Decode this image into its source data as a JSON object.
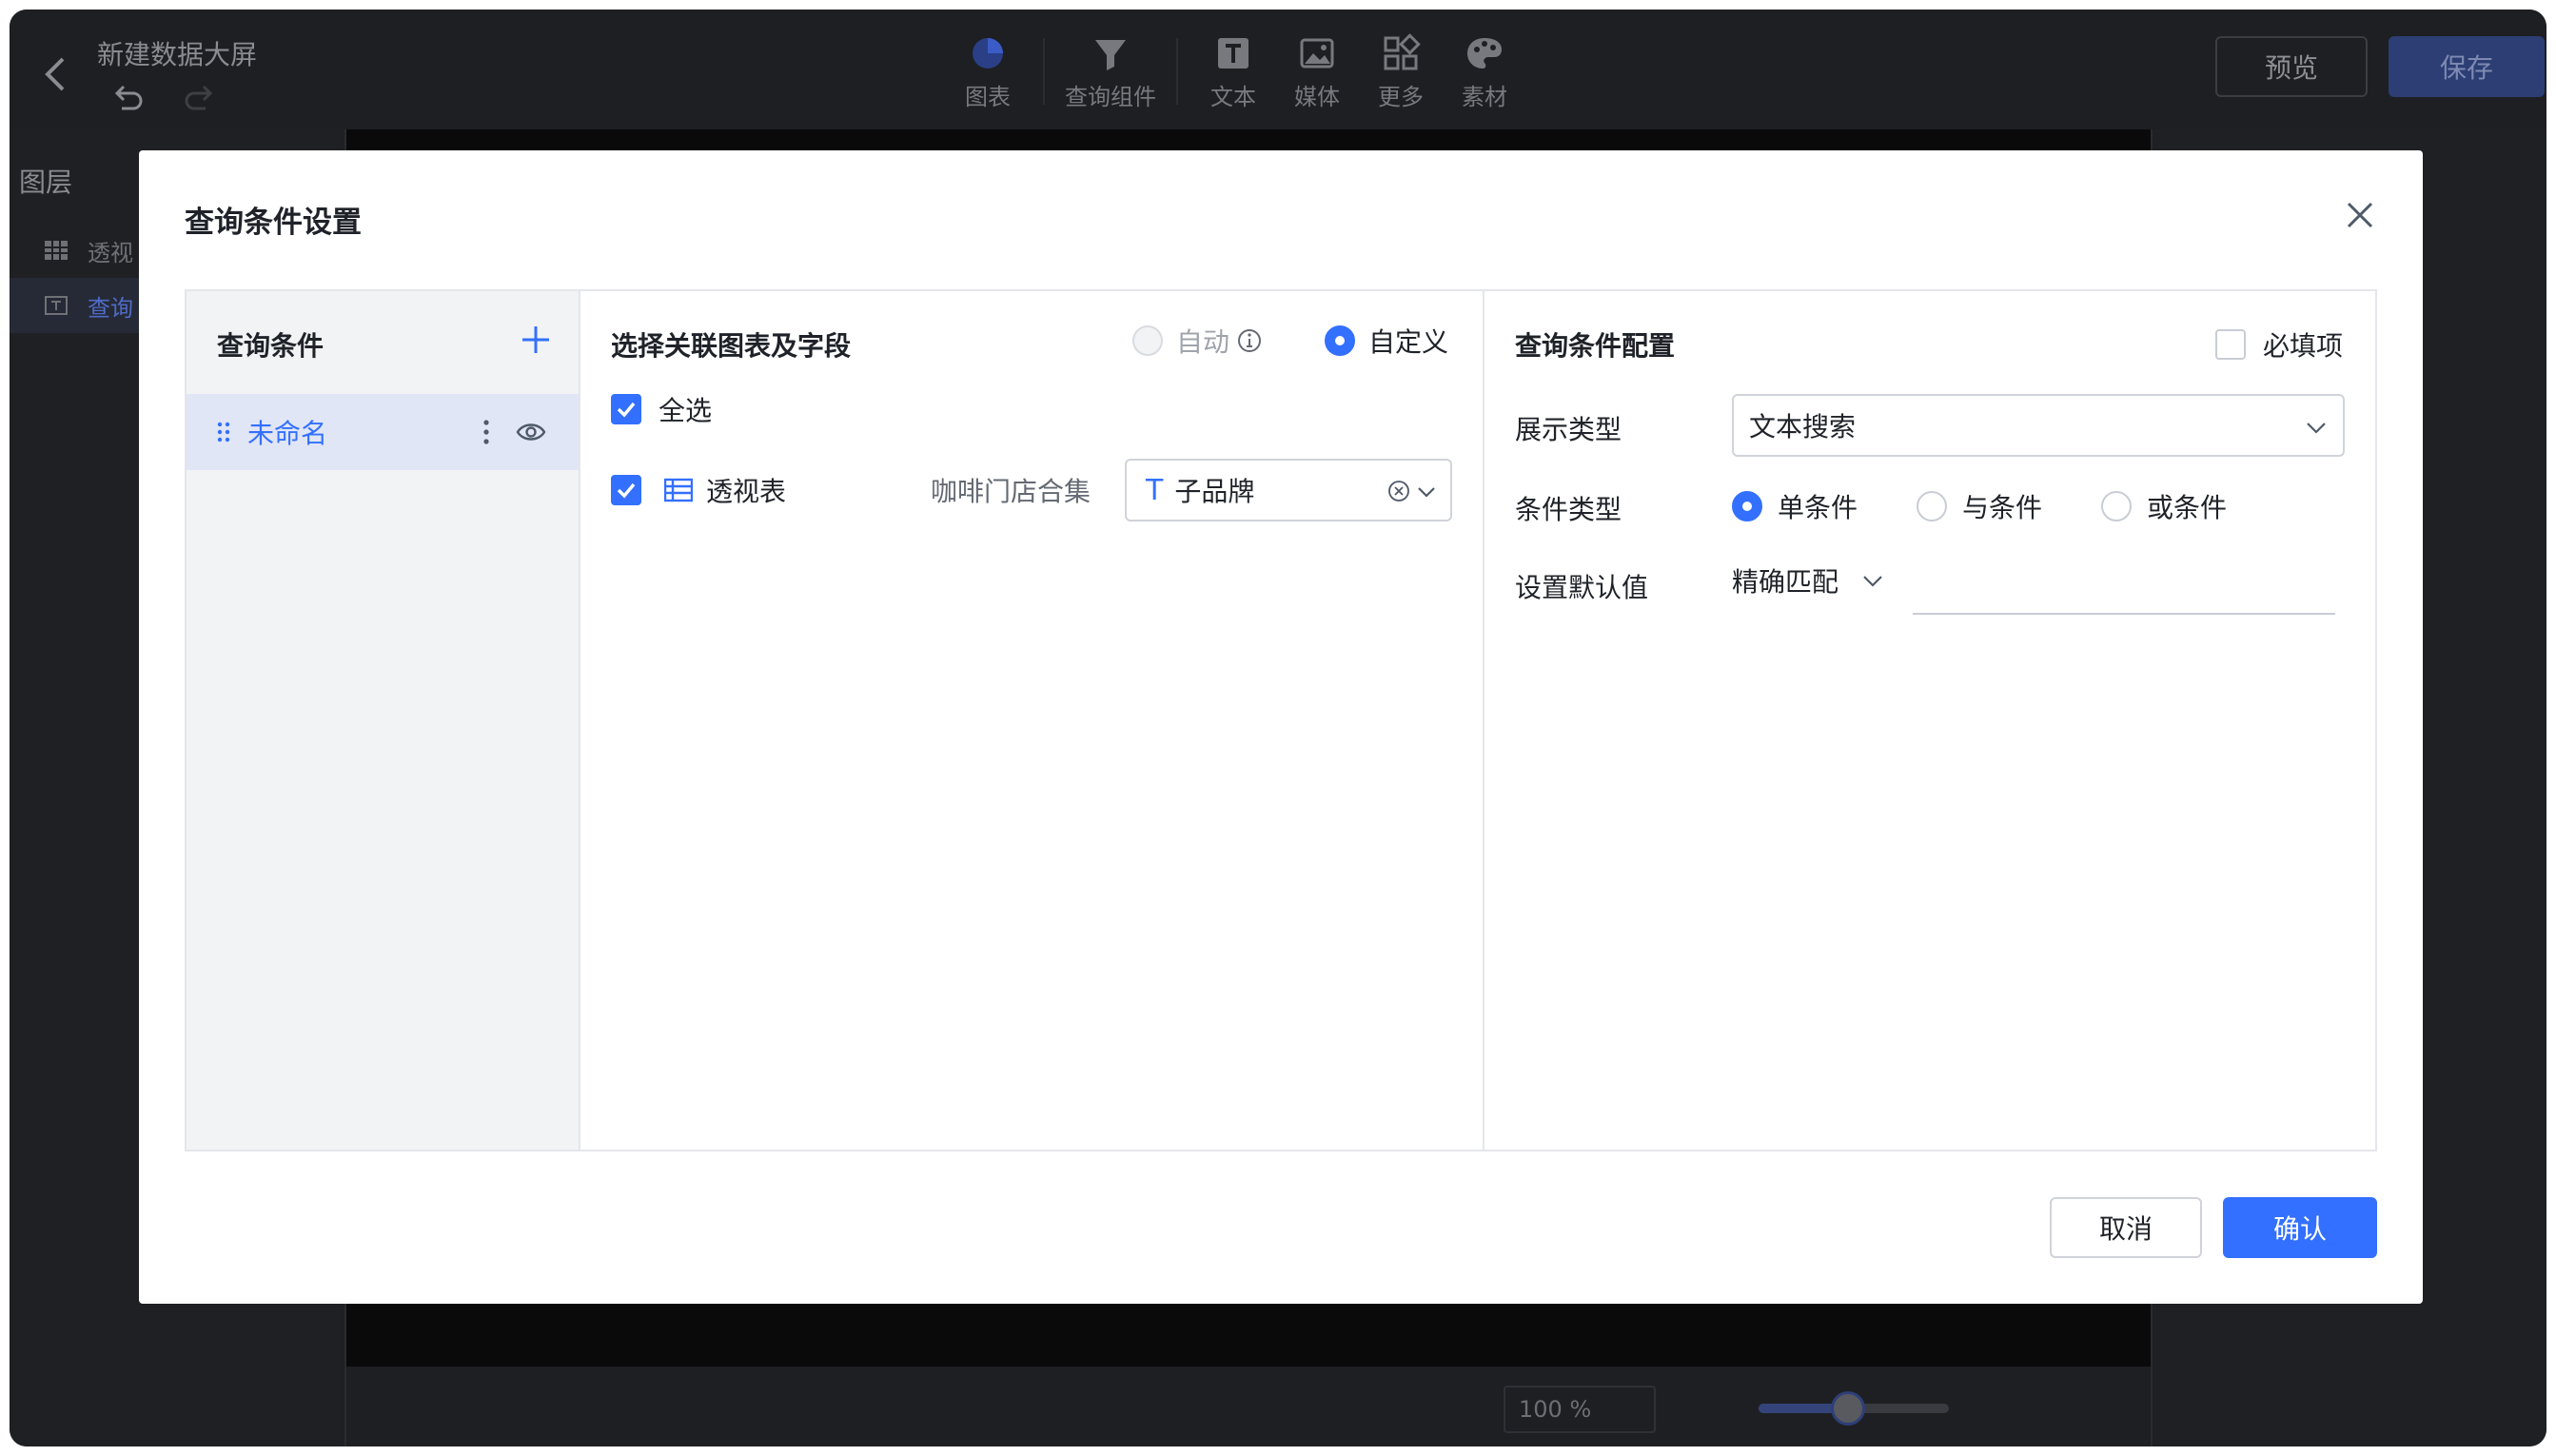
{
  "app": {
    "title": "新建数据大屏",
    "toolbar": [
      {
        "label": "图表",
        "icon": "pie-chart-icon"
      },
      {
        "label": "查询组件",
        "icon": "filter-funnel-icon"
      },
      {
        "label": "文本",
        "icon": "text-icon"
      },
      {
        "label": "媒体",
        "icon": "image-icon"
      },
      {
        "label": "更多",
        "icon": "grid-more-icon"
      },
      {
        "label": "素材",
        "icon": "palette-icon"
      }
    ],
    "preview_label": "预览",
    "save_label": "保存",
    "layers": {
      "title": "图层",
      "items": [
        {
          "label": "透视",
          "icon": "table-icon"
        },
        {
          "label": "查询",
          "icon": "text-box-icon",
          "active": true
        }
      ]
    },
    "zoom": {
      "value": "100",
      "unit": "%"
    }
  },
  "modal": {
    "title": "查询条件设置",
    "conditions": {
      "header": "查询条件",
      "items": [
        {
          "name": "未命名"
        }
      ]
    },
    "association": {
      "header": "选择关联图表及字段",
      "mode_auto": "自动",
      "mode_custom": "自定义",
      "select_all": "全选",
      "charts": [
        {
          "name": "透视表",
          "dataset": "咖啡门店合集",
          "field": "子品牌",
          "field_type_icon": "T"
        }
      ]
    },
    "config": {
      "header": "查询条件配置",
      "required_label": "必填项",
      "display_type_label": "展示类型",
      "display_type_value": "文本搜索",
      "condition_type_label": "条件类型",
      "condition_types": [
        "单条件",
        "与条件",
        "或条件"
      ],
      "default_label": "设置默认值",
      "match_mode": "精确匹配",
      "default_value": ""
    },
    "cancel_label": "取消",
    "ok_label": "确认"
  },
  "colors": {
    "accent": "#3370ff",
    "selected_row": "#e1e6f6",
    "overlay_bg": "#1b1c1f"
  }
}
